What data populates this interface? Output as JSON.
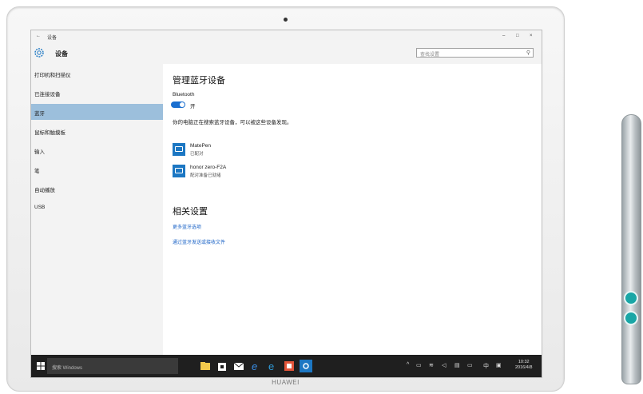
{
  "device": {
    "brand": "HUAWEI"
  },
  "window": {
    "titlebar": {
      "back": "←",
      "app_name": "设备",
      "minimize": "–",
      "maximize": "□",
      "close": "×"
    },
    "header_title": "设备",
    "search_placeholder": "查找设置",
    "search_icon": "search-icon"
  },
  "sidebar": {
    "items": [
      {
        "label": "打印机和扫描仪"
      },
      {
        "label": "已连接设备"
      },
      {
        "label": "蓝牙",
        "active": true
      },
      {
        "label": "鼠标和触摸板"
      },
      {
        "label": "输入"
      },
      {
        "label": "笔"
      },
      {
        "label": "自动播放"
      },
      {
        "label": "USB"
      }
    ]
  },
  "main": {
    "title": "管理蓝牙设备",
    "bluetooth_label": "Bluetooth",
    "toggle_state_label": "开",
    "discovery_note": "你的电脑正在搜索蓝牙设备，可以被这些设备发现。",
    "devices": [
      {
        "name": "MatePen",
        "status": "已配对"
      },
      {
        "name": "honor zero-F2A",
        "status": "配对准备已就绪"
      }
    ],
    "related_title": "相关设置",
    "related_links": [
      {
        "label": "更多蓝牙选项"
      },
      {
        "label": "通过蓝牙发送或接收文件"
      }
    ]
  },
  "taskbar": {
    "search_placeholder": "搜索 Windows",
    "apps": [
      "file-explorer-icon",
      "store-icon",
      "mail-icon",
      "edge-icon",
      "ie-icon",
      "office-icon",
      "settings-icon"
    ],
    "clock_time": "10:32",
    "clock_date": "2016/4/8",
    "ime_label": "中"
  },
  "colors": {
    "accent": "#1c77c3",
    "selected_bg": "#9cbfdc",
    "taskbar_bg": "#1f1f1f",
    "pen_button": "#1aa6a6"
  }
}
